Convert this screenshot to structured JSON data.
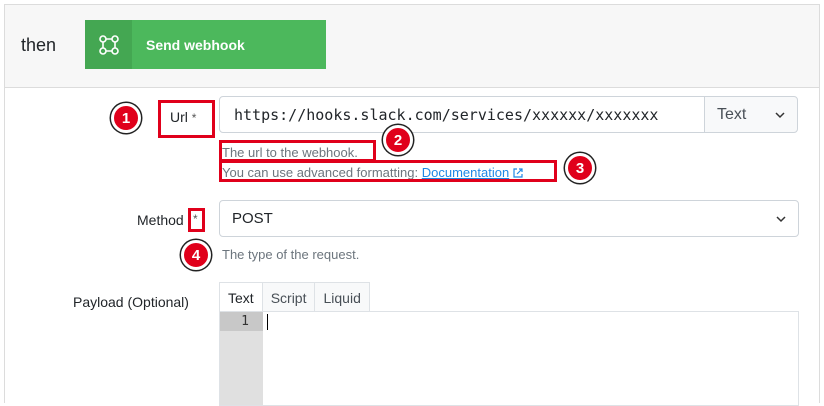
{
  "header": {
    "then_label": "then",
    "action_button": {
      "label": "Send webhook",
      "icon": "webhook-icon"
    }
  },
  "url_field": {
    "label": "Url",
    "required_marker": "*",
    "value": "https://hooks.slack.com/services/xxxxxx/xxxxxxx",
    "type_select": {
      "selected": "Text"
    },
    "help_text": "The url to the webhook.",
    "formatting_text": "You can use advanced formatting:",
    "documentation_link": "Documentation",
    "external_icon": "external-link-icon"
  },
  "method_field": {
    "label": "Method",
    "required_marker": "*",
    "selected": "POST",
    "help_text": "The type of the request."
  },
  "payload_field": {
    "label": "Payload (Optional)",
    "tabs": [
      {
        "label": "Text",
        "active": true
      },
      {
        "label": "Script",
        "active": false
      },
      {
        "label": "Liquid",
        "active": false
      }
    ],
    "editor": {
      "line_numbers": [
        "1"
      ],
      "content": ""
    }
  },
  "annotations": [
    {
      "number": "1"
    },
    {
      "number": "2"
    },
    {
      "number": "3"
    },
    {
      "number": "4"
    }
  ],
  "colors": {
    "button_green": "#4cb85c",
    "button_icon_green": "#44a752",
    "annotation_red": "#e0001b",
    "link_blue": "#1e88e5"
  }
}
